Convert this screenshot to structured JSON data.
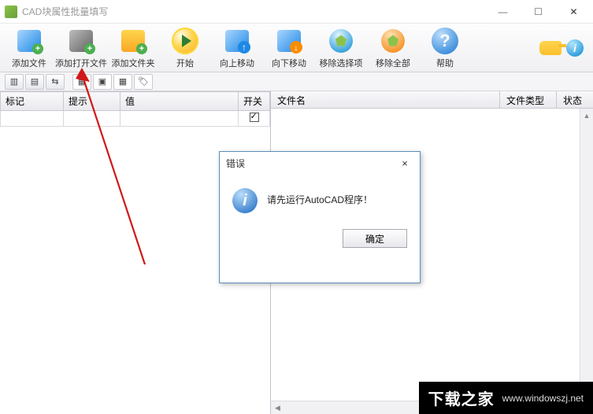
{
  "window": {
    "title": "CAD块属性批量填写",
    "min_tip": "最小化",
    "max_tip": "最大化",
    "close_tip": "关闭"
  },
  "toolbar": {
    "items": [
      {
        "label": "添加文件",
        "icon": "add-file-icon"
      },
      {
        "label": "添加打开文件",
        "icon": "add-open-file-icon"
      },
      {
        "label": "添加文件夹",
        "icon": "add-folder-icon"
      },
      {
        "label": "开始",
        "icon": "start-icon"
      },
      {
        "label": "向上移动",
        "icon": "move-up-icon"
      },
      {
        "label": "向下移动",
        "icon": "move-down-icon"
      },
      {
        "label": "移除选择项",
        "icon": "remove-sel-icon"
      },
      {
        "label": "移除全部",
        "icon": "remove-all-icon"
      },
      {
        "label": "帮助",
        "icon": "help-icon"
      }
    ]
  },
  "left_table": {
    "headers": {
      "mark": "标记",
      "hint": "提示",
      "value": "值",
      "switch": "开关"
    },
    "rows": [
      {
        "mark": "",
        "hint": "",
        "value": "",
        "checked": true
      }
    ]
  },
  "right_table": {
    "headers": {
      "fname": "文件名",
      "ftype": "文件类型",
      "fstat": "状态"
    }
  },
  "dialog": {
    "title": "错误",
    "message": "请先运行AutoCAD程序！",
    "ok": "确定",
    "close": "×"
  },
  "watermark": {
    "brand": "下载之家",
    "url": "www.windowszj.net"
  }
}
